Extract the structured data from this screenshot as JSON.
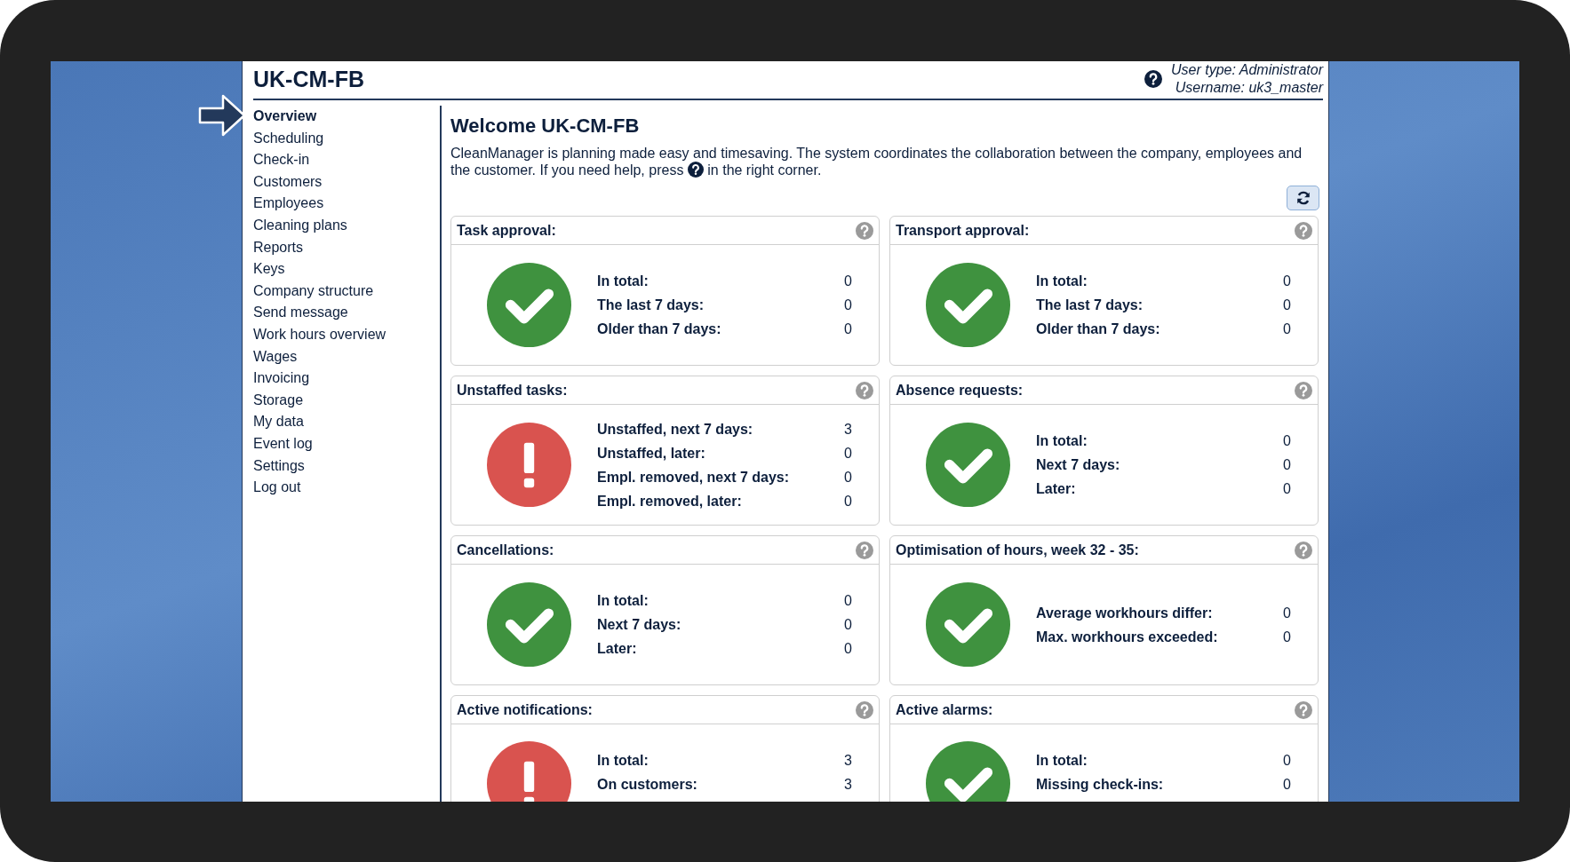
{
  "header": {
    "title": "UK-CM-FB",
    "user_type": "User type: Administrator",
    "username": "Username: uk3_master"
  },
  "menu": [
    {
      "label": "Overview",
      "selected": true
    },
    {
      "label": "Scheduling",
      "selected": false
    },
    {
      "label": "Check-in",
      "selected": false
    },
    {
      "label": "Customers",
      "selected": false
    },
    {
      "label": "Employees",
      "selected": false
    },
    {
      "label": "Cleaning plans",
      "selected": false
    },
    {
      "label": "Reports",
      "selected": false
    },
    {
      "label": "Keys",
      "selected": false
    },
    {
      "label": "Company structure",
      "selected": false
    },
    {
      "label": "Send message",
      "selected": false
    },
    {
      "label": "Work hours overview",
      "selected": false
    },
    {
      "label": "Wages",
      "selected": false
    },
    {
      "label": "Invoicing",
      "selected": false
    },
    {
      "label": "Storage",
      "selected": false
    },
    {
      "label": "My data",
      "selected": false
    },
    {
      "label": "Event log",
      "selected": false
    },
    {
      "label": "Settings",
      "selected": false
    },
    {
      "label": "Log out",
      "selected": false
    }
  ],
  "welcome": {
    "heading": "Welcome UK-CM-FB",
    "intro_line": "CleanManager is planning made easy and timesaving. The system coordinates the collaboration between the company, employees and",
    "intro_before": "the customer. If you need help, press",
    "intro_after": "in the right corner."
  },
  "cards": [
    {
      "title": "Task approval:",
      "kind": "ok",
      "rows": [
        {
          "label": "In total:",
          "value": "0"
        },
        {
          "label": "The last 7 days:",
          "value": "0"
        },
        {
          "label": "Older than 7 days:",
          "value": "0"
        }
      ]
    },
    {
      "title": "Transport approval:",
      "kind": "ok",
      "rows": [
        {
          "label": "In total:",
          "value": "0"
        },
        {
          "label": "The last 7 days:",
          "value": "0"
        },
        {
          "label": "Older than 7 days:",
          "value": "0"
        }
      ]
    },
    {
      "title": "Unstaffed tasks:",
      "kind": "alert",
      "rows": [
        {
          "label": "Unstaffed, next 7 days:",
          "value": "3"
        },
        {
          "label": "Unstaffed, later:",
          "value": "0"
        },
        {
          "label": "Empl. removed, next 7 days:",
          "value": "0"
        },
        {
          "label": "Empl. removed, later:",
          "value": "0"
        }
      ]
    },
    {
      "title": "Absence requests:",
      "kind": "ok",
      "rows": [
        {
          "label": "In total:",
          "value": "0"
        },
        {
          "label": "Next 7 days:",
          "value": "0"
        },
        {
          "label": "Later:",
          "value": "0"
        }
      ]
    },
    {
      "title": "Cancellations:",
      "kind": "ok",
      "rows": [
        {
          "label": "In total:",
          "value": "0"
        },
        {
          "label": "Next 7 days:",
          "value": "0"
        },
        {
          "label": "Later:",
          "value": "0"
        }
      ]
    },
    {
      "title": "Optimisation of hours, week 32 - 35:",
      "kind": "ok",
      "rows": [
        {
          "label": "Average workhours differ:",
          "value": "0"
        },
        {
          "label": "Max. workhours exceeded:",
          "value": "0"
        }
      ]
    },
    {
      "title": "Active notifications:",
      "kind": "alert",
      "rows": [
        {
          "label": "In total:",
          "value": "3"
        },
        {
          "label": "On customers:",
          "value": "3"
        }
      ]
    },
    {
      "title": "Active alarms:",
      "kind": "ok",
      "rows": [
        {
          "label": "In total:",
          "value": "0"
        },
        {
          "label": "Missing check-ins:",
          "value": "0"
        }
      ]
    }
  ]
}
